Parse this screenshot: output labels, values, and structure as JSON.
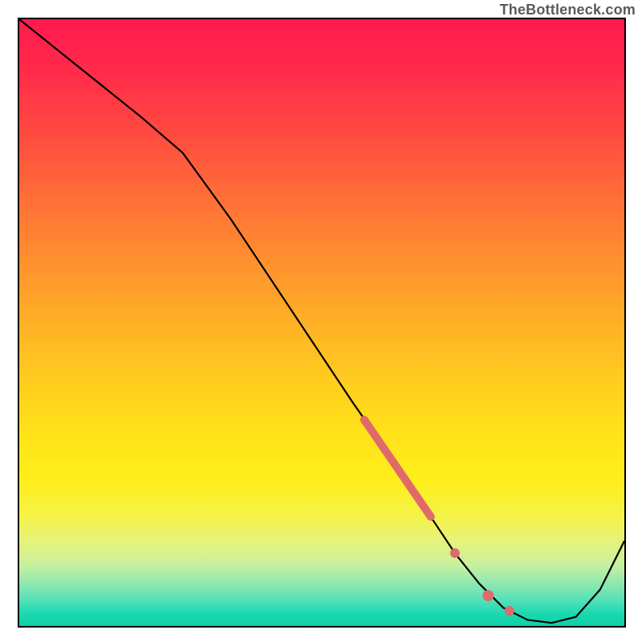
{
  "watermark": "TheBottleneck.com",
  "chart_data": {
    "type": "line",
    "title": "",
    "xlabel": "",
    "ylabel": "",
    "xlim": [
      0,
      100
    ],
    "ylim": [
      0,
      100
    ],
    "grid": false,
    "gradient_stops": [
      {
        "pos": 0,
        "color": "#ff1a4d"
      },
      {
        "pos": 18,
        "color": "#ff4740"
      },
      {
        "pos": 38,
        "color": "#ff8a30"
      },
      {
        "pos": 58,
        "color": "#ffc820"
      },
      {
        "pos": 78,
        "color": "#ffee1a"
      },
      {
        "pos": 90,
        "color": "#c8f0a0"
      },
      {
        "pos": 100,
        "color": "#10d0a8"
      }
    ],
    "series": [
      {
        "name": "curve",
        "stroke": "#000000",
        "stroke_width": 2.2,
        "x": [
          0,
          10,
          20,
          27,
          35,
          45,
          55,
          62,
          68,
          72,
          76,
          80,
          84,
          88,
          92,
          96,
          100
        ],
        "y": [
          100,
          92,
          84,
          78,
          67,
          52,
          37,
          27,
          18,
          12,
          7,
          3,
          1,
          0.5,
          1.5,
          6,
          14
        ]
      }
    ],
    "markers": [
      {
        "name": "highlight-segment",
        "kind": "thick-line",
        "color": "#e06a6a",
        "width": 10,
        "x": [
          57,
          68
        ],
        "y": [
          34,
          18
        ]
      },
      {
        "name": "dot-1",
        "kind": "dot",
        "color": "#e06a6a",
        "radius": 6,
        "x": 72,
        "y": 12
      },
      {
        "name": "dot-2",
        "kind": "dot",
        "color": "#e06a6a",
        "radius": 7,
        "x": 77.5,
        "y": 5
      },
      {
        "name": "dot-3",
        "kind": "dot",
        "color": "#e06a6a",
        "radius": 6,
        "x": 81,
        "y": 2.5
      }
    ]
  }
}
